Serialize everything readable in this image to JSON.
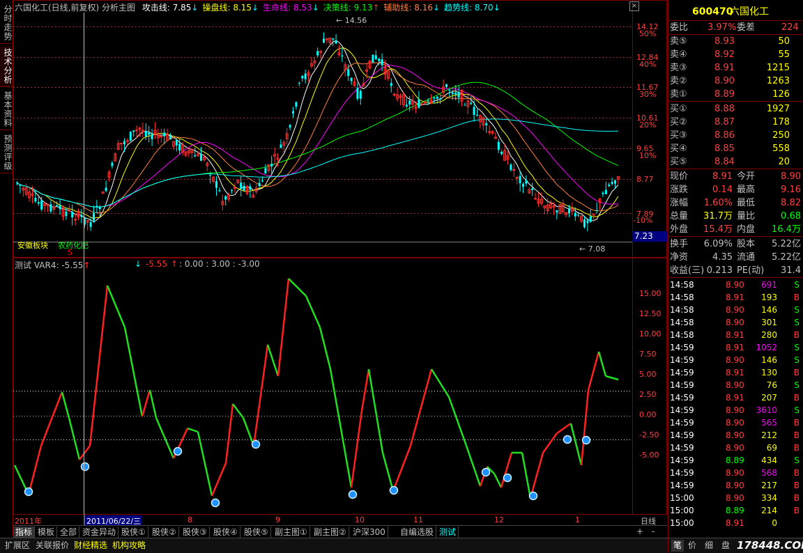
{
  "left_tabs": [
    "分时走势",
    "技术分析",
    "基本资料",
    "预测评级"
  ],
  "main_header": {
    "title": "六国化工(日线,前复权) 分析主图",
    "items": [
      {
        "label": "攻击线: 7.85",
        "arrow": "↓",
        "color": "#ffffff"
      },
      {
        "label": "操盘线: 8.15",
        "arrow": "↓",
        "color": "#ffff00"
      },
      {
        "label": "生命线: 8.53",
        "arrow": "↓",
        "color": "#ff00ff"
      },
      {
        "label": "决策线: 9.13",
        "arrow": "↑",
        "color": "#00ff00"
      },
      {
        "label": "辅助线: 8.16",
        "arrow": "↓",
        "color": "#ff8040"
      },
      {
        "label": "趋势线: 8.70",
        "arrow": "↓",
        "color": "#00ffff"
      }
    ]
  },
  "price_axis": {
    "labels": [
      "14.12",
      "12.84",
      "11.67",
      "10.61",
      "9.65",
      "8.77",
      "7.89"
    ],
    "pct": [
      "50%",
      "40%",
      "30%",
      "20%",
      "10%",
      "-10%"
    ],
    "current": "7.23"
  },
  "annotations": {
    "high": "14.56",
    "low": "7.08",
    "sector1": "安徽板块",
    "sector2": "农药化肥",
    "marker": "S"
  },
  "indicator_header": {
    "name": "测试",
    "var": "VAR4: -5.55",
    "extra": "-5.55",
    "values": ": 0.00 : 3.00 : -3.00"
  },
  "indicator_axis": [
    "15.00",
    "12.50",
    "10.00",
    "7.50",
    "5.00",
    "2.50",
    "0.00",
    "-2.50",
    "-5.00"
  ],
  "date_axis": {
    "labels": [
      "2011年",
      "8",
      "9",
      "10",
      "11",
      "12",
      "1"
    ],
    "cursor": "2011/06/22/三",
    "period": "日线"
  },
  "indicator_tabs": [
    "指标",
    "模板",
    "全部",
    "资金异动",
    "股侠①",
    "股侠②",
    "股侠③",
    "股侠④",
    "股侠⑤",
    "副主图①",
    "副主图②",
    "沪深300",
    "自编选股",
    "测试"
  ],
  "bottom_tabs": [
    "扩展区",
    "关联报价",
    "财经精选",
    "机构攻略"
  ],
  "quote": {
    "code": "600470",
    "name": "六国化工",
    "wb_label": "委比",
    "wb": "3.97%",
    "wc_label": "委差",
    "wc": "224",
    "sell": [
      {
        "l": "卖⑤",
        "p": "8.93",
        "v": "50"
      },
      {
        "l": "卖④",
        "p": "8.92",
        "v": "55"
      },
      {
        "l": "卖③",
        "p": "8.91",
        "v": "1215"
      },
      {
        "l": "卖②",
        "p": "8.90",
        "v": "1263"
      },
      {
        "l": "卖①",
        "p": "8.89",
        "v": "126"
      }
    ],
    "buy": [
      {
        "l": "买①",
        "p": "8.88",
        "v": "1927"
      },
      {
        "l": "买②",
        "p": "8.87",
        "v": "178"
      },
      {
        "l": "买③",
        "p": "8.86",
        "v": "250"
      },
      {
        "l": "买④",
        "p": "8.85",
        "v": "558"
      },
      {
        "l": "买⑤",
        "p": "8.84",
        "v": "20"
      }
    ],
    "stats": [
      {
        "a": "现价",
        "av": "8.91",
        "b": "今开",
        "bv": "8.90",
        "ac": "#ff4040",
        "bc": "#ff4040"
      },
      {
        "a": "涨跌",
        "av": "0.14",
        "b": "最高",
        "bv": "9.16",
        "ac": "#ff4040",
        "bc": "#ff4040"
      },
      {
        "a": "涨幅",
        "av": "1.60%",
        "b": "最低",
        "bv": "8.82",
        "ac": "#ff4040",
        "bc": "#ff4040"
      },
      {
        "a": "总量",
        "av": "31.7万",
        "b": "量比",
        "bv": "0.68",
        "ac": "#ffff00",
        "bc": "#00ff00"
      },
      {
        "a": "外盘",
        "av": "15.4万",
        "b": "内盘",
        "bv": "16.4万",
        "ac": "#ff4040",
        "bc": "#00ff00"
      }
    ],
    "fund": [
      {
        "a": "换手",
        "av": "6.09%",
        "b": "股本",
        "bv": "5.22亿"
      },
      {
        "a": "净资",
        "av": "4.35",
        "b": "流通",
        "bv": "5.22亿"
      },
      {
        "a": "收益(三)",
        "av": "0.213",
        "b": "PE(动)",
        "bv": "31.4"
      }
    ]
  },
  "ticks": [
    {
      "t": "14:58",
      "p": "8.90",
      "v": "691",
      "s": "S"
    },
    {
      "t": "14:58",
      "p": "8.91",
      "v": "193",
      "s": "B"
    },
    {
      "t": "14:58",
      "p": "8.90",
      "v": "146",
      "s": "S"
    },
    {
      "t": "14:58",
      "p": "8.90",
      "v": "301",
      "s": "S"
    },
    {
      "t": "14:58",
      "p": "8.91",
      "v": "280",
      "s": "B"
    },
    {
      "t": "14:59",
      "p": "8.91",
      "v": "1052",
      "s": "S"
    },
    {
      "t": "14:59",
      "p": "8.90",
      "v": "146",
      "s": "S"
    },
    {
      "t": "14:59",
      "p": "8.91",
      "v": "130",
      "s": "B"
    },
    {
      "t": "14:59",
      "p": "8.90",
      "v": "76",
      "s": "S"
    },
    {
      "t": "14:59",
      "p": "8.91",
      "v": "207",
      "s": "B"
    },
    {
      "t": "14:59",
      "p": "8.90",
      "v": "3610",
      "s": "S"
    },
    {
      "t": "14:59",
      "p": "8.90",
      "v": "565",
      "s": "B"
    },
    {
      "t": "14:59",
      "p": "8.90",
      "v": "212",
      "s": "B"
    },
    {
      "t": "14:59",
      "p": "8.90",
      "v": "69",
      "s": "B"
    },
    {
      "t": "14:59",
      "p": "8.89",
      "v": "434",
      "s": "S"
    },
    {
      "t": "14:59",
      "p": "8.90",
      "v": "568",
      "s": "B"
    },
    {
      "t": "14:59",
      "p": "8.90",
      "v": "217",
      "s": "B"
    },
    {
      "t": "15:00",
      "p": "8.90",
      "v": "334",
      "s": "B"
    },
    {
      "t": "15:00",
      "p": "8.89",
      "v": "214",
      "s": "B"
    },
    {
      "t": "15:00",
      "p": "8.91",
      "v": "0",
      "s": ""
    }
  ],
  "right_tabs": [
    "笔",
    "价",
    "细",
    "盘"
  ],
  "watermark": "178448.COM"
}
